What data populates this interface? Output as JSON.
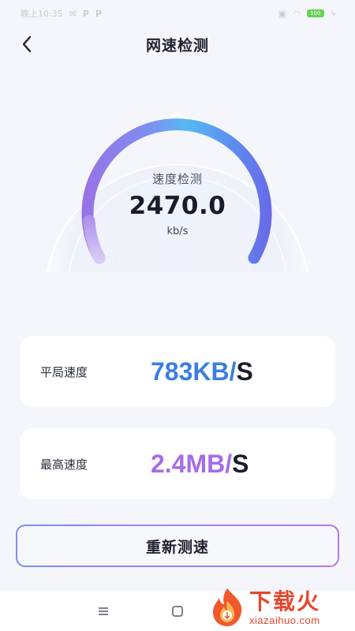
{
  "status_bar": {
    "time": "晚上10:35",
    "notification_icons": [
      "email-icon",
      "p-app-icon",
      "p-app-icon"
    ],
    "battery": "100"
  },
  "header": {
    "title": "网速检测",
    "back_icon": "chevron-left-icon"
  },
  "gauge": {
    "label": "速度检测",
    "value": "2470.0",
    "unit": "kb/s",
    "gradient_colors": [
      "#c6a9f3",
      "#9b6fe6",
      "#5d9ef0",
      "#57b9f2",
      "#6b70ea"
    ]
  },
  "stats": {
    "average": {
      "label": "平局速度",
      "value": "783KB/",
      "suffix": "S",
      "color": "#3b7fde"
    },
    "max": {
      "label": "最高速度",
      "value": "2.4MB/",
      "suffix": "S",
      "color": "#a56ce8"
    }
  },
  "retest_button": {
    "label": "重新测速"
  },
  "nav_bar": {
    "icons": [
      "menu-icon",
      "home-square-icon"
    ]
  },
  "watermark": {
    "cn": "下载火",
    "en": "xiazaihuo.com"
  }
}
